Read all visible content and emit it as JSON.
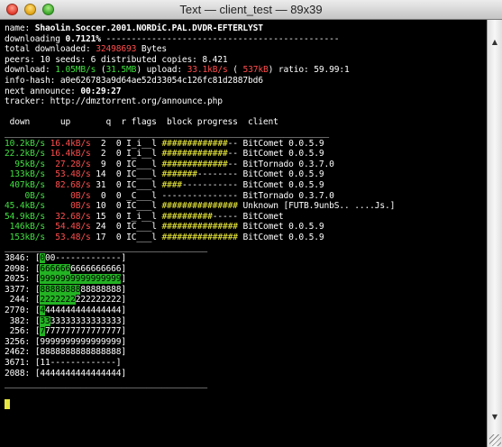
{
  "window": {
    "title": "Text — client_test — 89x39"
  },
  "info": [
    [
      {
        "t": "name: "
      },
      {
        "t": "Shaolin.Soccer.2001.NORDiC.PAL.DVDR-EFTERLYST",
        "s": "b"
      }
    ],
    [
      {
        "t": "downloading "
      },
      {
        "t": "0.7121%",
        "s": "b"
      },
      {
        "t": " ----------------------------------------------"
      }
    ],
    [
      {
        "t": "total downloaded: "
      },
      {
        "t": "32498693",
        "s": "r"
      },
      {
        "t": " Bytes"
      }
    ],
    [
      {
        "t": "peers: 10 seeds: 6 distributed copies: 8.421"
      }
    ],
    [
      {
        "t": "download: "
      },
      {
        "t": "1.05MB/s",
        "s": "g"
      },
      {
        "t": " ("
      },
      {
        "t": "31.5MB",
        "s": "g"
      },
      {
        "t": ") upload: "
      },
      {
        "t": "33.1kB/s",
        "s": "r"
      },
      {
        "t": " ( "
      },
      {
        "t": "537kB",
        "s": "r"
      },
      {
        "t": ") ratio: 59.99:1"
      }
    ],
    [
      {
        "t": "info-hash: a0e626783a9d64ae52d33054c126fc81d2887bd6"
      }
    ],
    [
      {
        "t": "next announce: "
      },
      {
        "t": "00:29:27",
        "s": "b"
      }
    ],
    [
      {
        "t": "tracker: http://dmztorrent.org/announce.php"
      }
    ],
    [
      {
        "t": ""
      }
    ],
    [
      {
        "t": " down      up       q  r flags  block progress  client"
      }
    ],
    [
      {
        "t": "________________________________________________________________"
      }
    ]
  ],
  "peers": [
    {
      "down": "10.2kB/s",
      "up": "16.4kB/s",
      "q": " 2",
      "r": " 0",
      "flags": "I_i__l",
      "progress_done": "#############",
      "progress_rest": "--",
      "client": "BitComet 0.0.5.9"
    },
    {
      "down": "22.2kB/s",
      "up": "16.4kB/s",
      "q": " 2",
      "r": " 0",
      "flags": "I_i__l",
      "progress_done": "#############",
      "progress_rest": "--",
      "client": "BitComet 0.0.5.9"
    },
    {
      "down": " 95kB/s",
      "up": "27.28/s",
      "q": " 9",
      "r": " 0",
      "flags": "IC___l",
      "progress_done": "#############",
      "progress_rest": "--",
      "client": "BitTornado 0.3.7.0"
    },
    {
      "down": " 133kB/s",
      "up": "53.48/s",
      "q": "14",
      "r": " 0",
      "flags": "IC___l",
      "progress_done": "#######",
      "progress_rest": "--------",
      "client": "BitComet 0.0.5.9"
    },
    {
      "down": " 407kB/s",
      "up": "82.68/s",
      "q": "31",
      "r": " 0",
      "flags": "IC___l",
      "progress_done": "####",
      "progress_rest": "-----------",
      "client": "BitComet 0.0.5.9"
    },
    {
      "down": "   0B/s",
      "up": "  0B/s",
      "q": " 0",
      "r": " 0",
      "flags": "_C___l",
      "progress_done": "",
      "progress_rest": "---------------",
      "client": "BitTornado 0.3.7.0"
    },
    {
      "down": "45.4kB/s",
      "up": "  0B/s",
      "q": "10",
      "r": " 0",
      "flags": "IC___l",
      "progress_done": "###############",
      "progress_rest": "",
      "client": "Unknown [FUTB.9unbS.. ....Js.]"
    },
    {
      "down": "54.9kB/s",
      "up": "32.68/s",
      "q": "15",
      "r": " 0",
      "flags": "I_i__l",
      "progress_done": "##########",
      "progress_rest": "-----",
      "client": "BitComet"
    },
    {
      "down": " 146kB/s",
      "up": "54.48/s",
      "q": "24",
      "r": " 0",
      "flags": "IC___l",
      "progress_done": "###############",
      "progress_rest": "",
      "client": "BitComet 0.0.5.9"
    },
    {
      "down": " 153kB/s",
      "up": "53.48/s",
      "q": "17",
      "r": " 0",
      "flags": "IC___l",
      "progress_done": "###############",
      "progress_rest": "",
      "client": "BitComet 0.0.5.9"
    }
  ],
  "separator": "________________________________________",
  "pieces": [
    {
      "index": "3846",
      "hl": "0",
      "rest": "00-------------]"
    },
    {
      "index": "2098",
      "hl": "666666",
      "rest": "6666666666]"
    },
    {
      "index": "2025",
      "hl": "9999999999999999",
      "rest": "]"
    },
    {
      "index": "3377",
      "hl": "88888888",
      "rest": "88888888]"
    },
    {
      "index": " 244",
      "hl": "2222222",
      "rest": "222222222]"
    },
    {
      "index": "2770",
      "hl": "4",
      "rest": "444444444444444]"
    },
    {
      "index": " 382",
      "hl": "33",
      "rest": "33333333333333]"
    },
    {
      "index": " 256",
      "hl": "7",
      "rest": "777777777777777]"
    },
    {
      "index": "3256",
      "hl": "",
      "rest": "9999999999999999]"
    },
    {
      "index": "2462",
      "hl": "",
      "rest": "8888888888888888]"
    },
    {
      "index": "3671",
      "hl": "",
      "rest": "11-------------]"
    },
    {
      "index": "2088",
      "hl": "",
      "rest": "4444444444444444]"
    }
  ],
  "colors": {
    "download": "#40e040",
    "upload": "#ff4d4d",
    "progress": "#f0f03c",
    "piece_highlight": "#23b323"
  }
}
